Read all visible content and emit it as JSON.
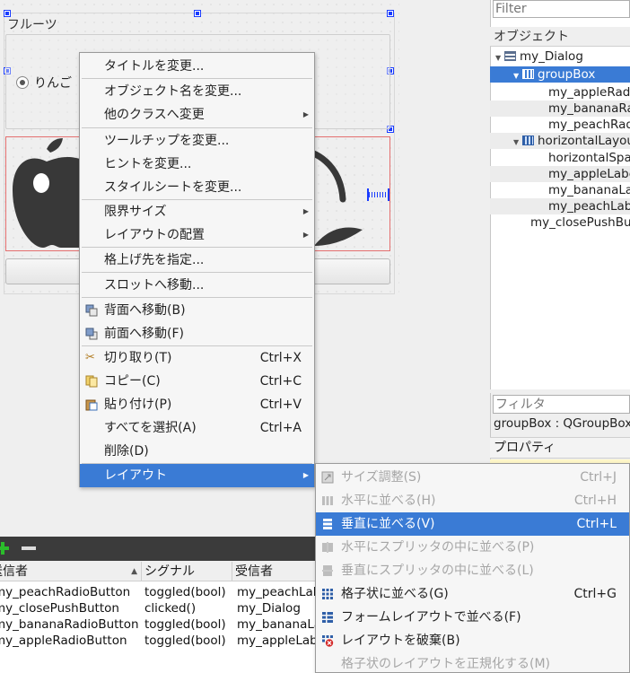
{
  "form": {
    "group_title": "フルーツ",
    "radio_apple_label": "りんご"
  },
  "object_inspector": {
    "filter_placeholder": "Filter",
    "header": "オブジェクト",
    "rows": [
      {
        "label": "my_Dialog"
      },
      {
        "label": "groupBox"
      },
      {
        "label": "my_appleRadioButton"
      },
      {
        "label": "my_bananaRadioButton"
      },
      {
        "label": "my_peachRadioButton"
      },
      {
        "label": "horizontalLayout"
      },
      {
        "label": "horizontalSpacer"
      },
      {
        "label": "my_appleLabel"
      },
      {
        "label": "my_bananaLabel"
      },
      {
        "label": "my_peachLabel"
      },
      {
        "label": "my_closePushButton"
      }
    ]
  },
  "property_editor": {
    "filter_placeholder": "フィルタ",
    "class_label": "groupBox : QGroupBox",
    "header": "プロパティ"
  },
  "signal_editor": {
    "columns": [
      "送信者",
      "シグナル",
      "受信者"
    ],
    "rows": [
      {
        "sender": "my_peachRadioButton",
        "signal": "toggled(bool)",
        "receiver": "my_peachLabel"
      },
      {
        "sender": "my_closePushButton",
        "signal": "clicked()",
        "receiver": "my_Dialog"
      },
      {
        "sender": "my_bananaRadioButton",
        "signal": "toggled(bool)",
        "receiver": "my_bananaLabel"
      },
      {
        "sender": "my_appleRadioButton",
        "signal": "toggled(bool)",
        "receiver": "my_appleLabel"
      }
    ]
  },
  "context_menu": {
    "items": [
      {
        "label": "タイトルを変更..."
      },
      {
        "label": "オブジェクト名を変更..."
      },
      {
        "label": "他のクラスへ変更"
      },
      {
        "label": "ツールチップを変更..."
      },
      {
        "label": "ヒントを変更..."
      },
      {
        "label": "スタイルシートを変更..."
      },
      {
        "label": "限界サイズ"
      },
      {
        "label": "レイアウトの配置"
      },
      {
        "label": "格上げ先を指定..."
      },
      {
        "label": "スロットへ移動..."
      },
      {
        "label": "背面へ移動(B)"
      },
      {
        "label": "前面へ移動(F)"
      },
      {
        "label": "切り取り(T)",
        "shortcut": "Ctrl+X"
      },
      {
        "label": "コピー(C)",
        "shortcut": "Ctrl+C"
      },
      {
        "label": "貼り付け(P)",
        "shortcut": "Ctrl+V"
      },
      {
        "label": "すべてを選択(A)",
        "shortcut": "Ctrl+A"
      },
      {
        "label": "削除(D)"
      },
      {
        "label": "レイアウト"
      }
    ]
  },
  "layout_submenu": {
    "items": [
      {
        "label": "サイズ調整(S)",
        "shortcut": "Ctrl+J"
      },
      {
        "label": "水平に並べる(H)",
        "shortcut": "Ctrl+H"
      },
      {
        "label": "垂直に並べる(V)",
        "shortcut": "Ctrl+L"
      },
      {
        "label": "水平にスプリッタの中に並べる(P)"
      },
      {
        "label": "垂直にスプリッタの中に並べる(L)"
      },
      {
        "label": "格子状に並べる(G)",
        "shortcut": "Ctrl+G"
      },
      {
        "label": "フォームレイアウトで並べる(F)"
      },
      {
        "label": "レイアウトを破棄(B)"
      },
      {
        "label": "格子状のレイアウトを正規化する(M)"
      }
    ]
  },
  "colors": {
    "selection": "#3a7bd5",
    "layout_red": "#e46f6f",
    "handle_blue": "#1a3cff",
    "fruit_dark": "#383838"
  }
}
